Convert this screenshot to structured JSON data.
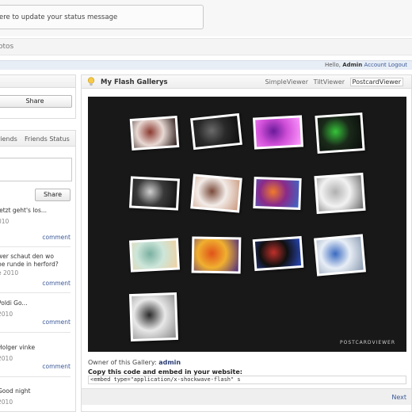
{
  "status": {
    "prompt": "ere to update your status message"
  },
  "nav": {
    "section": "otos"
  },
  "userbar": {
    "hello": "Hello,",
    "user": "Admin",
    "account": "Account",
    "logout": "Logout"
  },
  "left": {
    "share_top": "Share",
    "tabs": [
      "riends",
      "Friends Status"
    ],
    "share_bottom": "Share",
    "feed": [
      {
        "text": "jetzt geht's los...",
        "date": "010",
        "comment": "comment"
      },
      {
        "text": "wer schaut den wo",
        "text2": "ne runde in herford?",
        "date": "e 2010",
        "comment": "comment"
      },
      {
        "text": "Poldi Go...",
        "date": "2010",
        "comment": "comment"
      },
      {
        "text": "Holger vinke",
        "date": "2010",
        "comment": "comment"
      },
      {
        "text": "Good night",
        "date": "2010",
        "comment": ""
      }
    ]
  },
  "gallery": {
    "title": "My Flash Gallerys",
    "views": [
      "SimpleViewer",
      "TiltViewer",
      "PostcardViewer"
    ],
    "brand": "POSTCARDVIEWER",
    "owner_label": "Owner of this Gallery:",
    "owner": "admin",
    "copy_label": "Copy this code and embed in your website:",
    "embed_code": "<embed type=\"application/x-shockwave-flash\" s",
    "next": "Next",
    "photos": [
      {
        "name": "photo-red-hair-portrait",
        "colors": [
          "#e9d9d4",
          "#8a3a30",
          "#2a1a18"
        ]
      },
      {
        "name": "photo-dark-concert",
        "colors": [
          "#2a2a2a",
          "#6a6a6a",
          "#0d0d0d"
        ]
      },
      {
        "name": "photo-purple-stage-lights",
        "colors": [
          "#d04fd8",
          "#6a1a9a",
          "#ff9cff"
        ]
      },
      {
        "name": "photo-green-dj",
        "colors": [
          "#1a2a1a",
          "#36c43a",
          "#0a0a0a"
        ]
      },
      {
        "name": "photo-bw-collage",
        "colors": [
          "#3a3a3a",
          "#cfcfcf",
          "#111111"
        ]
      },
      {
        "name": "photo-woman-portrait",
        "colors": [
          "#f3ece8",
          "#7a4a3a",
          "#c99a80"
        ]
      },
      {
        "name": "photo-colorful-swirl",
        "colors": [
          "#8a2a8a",
          "#f07a2a",
          "#3a6ac8"
        ]
      },
      {
        "name": "photo-white-figure",
        "colors": [
          "#f2f2f2",
          "#b0b0b0",
          "#6a6a6a"
        ]
      },
      {
        "name": "photo-pastel-art",
        "colors": [
          "#cde6da",
          "#7ab0a0",
          "#f0d0a0"
        ]
      },
      {
        "name": "photo-orange-graphic",
        "colors": [
          "#f0b030",
          "#e0531a",
          "#4a2a80"
        ]
      },
      {
        "name": "photo-dark-party",
        "colors": [
          "#101010",
          "#c0302a",
          "#2a4ac0"
        ]
      },
      {
        "name": "photo-blue-club",
        "colors": [
          "#e8eef6",
          "#3a6ac0",
          "#8a9ab0"
        ]
      },
      {
        "name": "photo-bw-polaroids",
        "colors": [
          "#e8e8e8",
          "#2a2a2a",
          "#8a8a8a"
        ]
      }
    ]
  }
}
